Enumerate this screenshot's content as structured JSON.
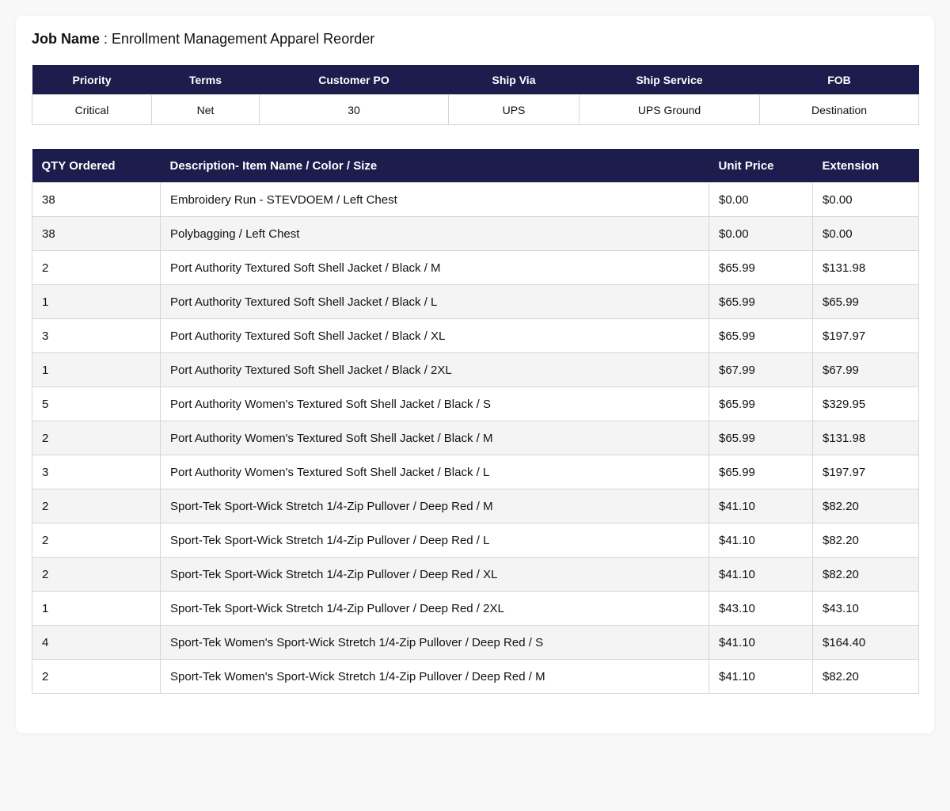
{
  "job": {
    "label": "Job Name",
    "value": " : Enrollment Management Apparel Reorder"
  },
  "meta": {
    "headers": [
      "Priority",
      "Terms",
      "Customer PO",
      "Ship Via",
      "Ship Service",
      "FOB"
    ],
    "values": [
      "Critical",
      "Net",
      "30",
      "UPS",
      "UPS Ground",
      "Destination"
    ]
  },
  "items": {
    "headers": [
      "QTY Ordered",
      "Description- Item Name / Color / Size",
      "Unit Price",
      "Extension"
    ],
    "rows": [
      [
        "38",
        "Embroidery Run - STEVDOEM / Left Chest",
        "$0.00",
        "$0.00"
      ],
      [
        "38",
        "Polybagging / Left Chest",
        "$0.00",
        "$0.00"
      ],
      [
        "2",
        "Port Authority Textured Soft Shell Jacket / Black / M",
        "$65.99",
        "$131.98"
      ],
      [
        "1",
        "Port Authority Textured Soft Shell Jacket / Black / L",
        "$65.99",
        "$65.99"
      ],
      [
        "3",
        "Port Authority Textured Soft Shell Jacket / Black / XL",
        "$65.99",
        "$197.97"
      ],
      [
        "1",
        "Port Authority Textured Soft Shell Jacket / Black / 2XL",
        "$67.99",
        "$67.99"
      ],
      [
        "5",
        "Port Authority Women's Textured Soft Shell Jacket / Black / S",
        "$65.99",
        "$329.95"
      ],
      [
        "2",
        "Port Authority Women's Textured Soft Shell Jacket / Black / M",
        "$65.99",
        "$131.98"
      ],
      [
        "3",
        "Port Authority Women's Textured Soft Shell Jacket / Black / L",
        "$65.99",
        "$197.97"
      ],
      [
        "2",
        "Sport-Tek Sport-Wick Stretch 1/4-Zip Pullover / Deep Red / M",
        "$41.10",
        "$82.20"
      ],
      [
        "2",
        "Sport-Tek Sport-Wick Stretch 1/4-Zip Pullover / Deep Red / L",
        "$41.10",
        "$82.20"
      ],
      [
        "2",
        "Sport-Tek Sport-Wick Stretch 1/4-Zip Pullover / Deep Red / XL",
        "$41.10",
        "$82.20"
      ],
      [
        "1",
        "Sport-Tek Sport-Wick Stretch 1/4-Zip Pullover / Deep Red / 2XL",
        "$43.10",
        "$43.10"
      ],
      [
        "4",
        "Sport-Tek Women's Sport-Wick Stretch 1/4-Zip Pullover / Deep Red / S",
        "$41.10",
        "$164.40"
      ],
      [
        "2",
        "Sport-Tek Women's Sport-Wick Stretch 1/4-Zip Pullover / Deep Red / M",
        "$41.10",
        "$82.20"
      ]
    ]
  },
  "colors": {
    "header_bg": "#1c1c4d",
    "header_text": "#ffffff",
    "row_alt": "#f4f4f4",
    "border": "#d6d6d6"
  }
}
